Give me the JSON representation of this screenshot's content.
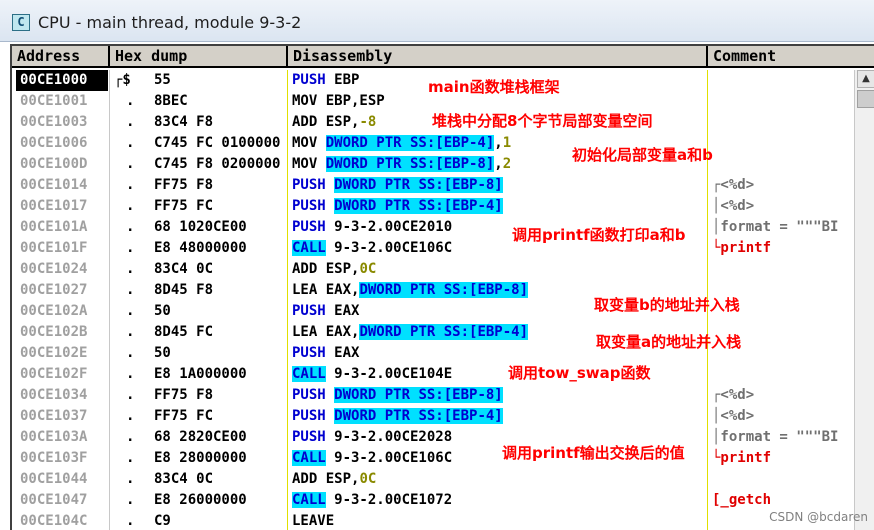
{
  "window": {
    "icon_letter": "C",
    "title": "CPU - main thread, module 9-3-2"
  },
  "columns": {
    "address": "Address",
    "hex": "Hex dump",
    "disasm": "Disassembly",
    "comment": "Comment"
  },
  "rows": [
    {
      "addr": "00CE1000",
      "mark": "┌$",
      "hex": "55",
      "dis": [
        [
          "PUSH",
          "kw"
        ],
        [
          " EBP",
          ""
        ]
      ],
      "cmt": ""
    },
    {
      "addr": "00CE1001",
      "mark": ".",
      "hex": "8BEC",
      "dis": [
        [
          "MOV EBP,ESP",
          ""
        ]
      ],
      "cmt": ""
    },
    {
      "addr": "00CE1003",
      "mark": ".",
      "hex": "83C4 F8",
      "dis": [
        [
          "ADD ESP,",
          ""
        ],
        [
          "-8",
          "num"
        ]
      ],
      "cmt": ""
    },
    {
      "addr": "00CE1006",
      "mark": ".",
      "hex": "C745 FC 0100000",
      "dis": [
        [
          "MOV ",
          ""
        ],
        [
          "DWORD PTR SS:[EBP-4]",
          "hl"
        ],
        [
          ",",
          ""
        ],
        [
          "1",
          "num"
        ]
      ],
      "cmt": ""
    },
    {
      "addr": "00CE100D",
      "mark": ".",
      "hex": "C745 F8 0200000",
      "dis": [
        [
          "MOV ",
          ""
        ],
        [
          "DWORD PTR SS:[EBP-8]",
          "hl"
        ],
        [
          ",",
          ""
        ],
        [
          "2",
          "num"
        ]
      ],
      "cmt": ""
    },
    {
      "addr": "00CE1014",
      "mark": ".",
      "hex": "FF75 F8",
      "dis": [
        [
          "PUSH",
          "kw"
        ],
        [
          " ",
          ""
        ],
        [
          "DWORD PTR SS:[EBP-8]",
          "hl"
        ]
      ],
      "cmt": "┌<%d>"
    },
    {
      "addr": "00CE1017",
      "mark": ".",
      "hex": "FF75 FC",
      "dis": [
        [
          "PUSH",
          "kw"
        ],
        [
          " ",
          ""
        ],
        [
          "DWORD PTR SS:[EBP-4]",
          "hl"
        ]
      ],
      "cmt": "│<%d>"
    },
    {
      "addr": "00CE101A",
      "mark": ".",
      "hex": "68 1020CE00",
      "dis": [
        [
          "PUSH",
          "kw"
        ],
        [
          " 9-3-2.00CE2010",
          ""
        ]
      ],
      "cmt": "│format = \"\"\"BI"
    },
    {
      "addr": "00CE101F",
      "mark": ".",
      "hex": "E8 48000000",
      "dis": [
        [
          "CALL",
          "hl"
        ],
        [
          " 9-3-2.00CE106C",
          ""
        ]
      ],
      "cmt": "└printf",
      "cmtRed": true
    },
    {
      "addr": "00CE1024",
      "mark": ".",
      "hex": "83C4 0C",
      "dis": [
        [
          "ADD ESP,",
          ""
        ],
        [
          "0C",
          "num"
        ]
      ],
      "cmt": ""
    },
    {
      "addr": "00CE1027",
      "mark": ".",
      "hex": "8D45 F8",
      "dis": [
        [
          "LEA EAX,",
          ""
        ],
        [
          "DWORD PTR SS:[EBP-8]",
          "hl"
        ]
      ],
      "cmt": ""
    },
    {
      "addr": "00CE102A",
      "mark": ".",
      "hex": "50",
      "dis": [
        [
          "PUSH",
          "kw"
        ],
        [
          " EAX",
          ""
        ]
      ],
      "cmt": ""
    },
    {
      "addr": "00CE102B",
      "mark": ".",
      "hex": "8D45 FC",
      "dis": [
        [
          "LEA EAX,",
          ""
        ],
        [
          "DWORD PTR SS:[EBP-4]",
          "hl"
        ]
      ],
      "cmt": ""
    },
    {
      "addr": "00CE102E",
      "mark": ".",
      "hex": "50",
      "dis": [
        [
          "PUSH",
          "kw"
        ],
        [
          " EAX",
          ""
        ]
      ],
      "cmt": ""
    },
    {
      "addr": "00CE102F",
      "mark": ".",
      "hex": "E8 1A000000",
      "dis": [
        [
          "CALL",
          "hl"
        ],
        [
          " 9-3-2.00CE104E",
          ""
        ]
      ],
      "cmt": ""
    },
    {
      "addr": "00CE1034",
      "mark": ".",
      "hex": "FF75 F8",
      "dis": [
        [
          "PUSH",
          "kw"
        ],
        [
          " ",
          ""
        ],
        [
          "DWORD PTR SS:[EBP-8]",
          "hl"
        ]
      ],
      "cmt": "┌<%d>"
    },
    {
      "addr": "00CE1037",
      "mark": ".",
      "hex": "FF75 FC",
      "dis": [
        [
          "PUSH",
          "kw"
        ],
        [
          " ",
          ""
        ],
        [
          "DWORD PTR SS:[EBP-4]",
          "hl"
        ]
      ],
      "cmt": "│<%d>"
    },
    {
      "addr": "00CE103A",
      "mark": ".",
      "hex": "68 2820CE00",
      "dis": [
        [
          "PUSH",
          "kw"
        ],
        [
          " 9-3-2.00CE2028",
          ""
        ]
      ],
      "cmt": "│format = \"\"\"BI"
    },
    {
      "addr": "00CE103F",
      "mark": ".",
      "hex": "E8 28000000",
      "dis": [
        [
          "CALL",
          "hl"
        ],
        [
          " 9-3-2.00CE106C",
          ""
        ]
      ],
      "cmt": "└printf",
      "cmtRed": true
    },
    {
      "addr": "00CE1044",
      "mark": ".",
      "hex": "83C4 0C",
      "dis": [
        [
          "ADD ESP,",
          ""
        ],
        [
          "0C",
          "num"
        ]
      ],
      "cmt": ""
    },
    {
      "addr": "00CE1047",
      "mark": ".",
      "hex": "E8 26000000",
      "dis": [
        [
          "CALL",
          "hl"
        ],
        [
          " 9-3-2.00CE1072",
          ""
        ]
      ],
      "cmt": "[_getch",
      "cmtRed": true
    },
    {
      "addr": "00CE104C",
      "mark": ".",
      "hex": "C9",
      "dis": [
        [
          "LEAVE",
          ""
        ]
      ],
      "cmt": ""
    }
  ],
  "annotations": [
    {
      "text": "main函数堆栈框架"
    },
    {
      "text": "堆栈中分配8个字节局部变量空间"
    },
    {
      "text": "初始化局部变量a和b"
    },
    {
      "text": "调用printf函数打印a和b"
    },
    {
      "text": "取变量b的地址并入栈"
    },
    {
      "text": "取变量a的地址并入栈"
    },
    {
      "text": "调用tow_swap函数"
    },
    {
      "text": "调用printf输出交换后的值"
    }
  ],
  "watermark": "CSDN @bcdaren"
}
